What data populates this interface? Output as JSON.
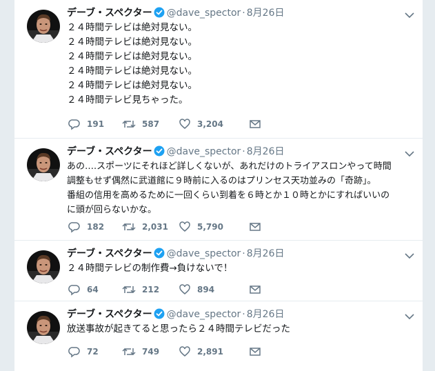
{
  "tweets": [
    {
      "name": "デーブ・スペクター",
      "handle": "@dave_spector",
      "date": "8月26日",
      "lines": [
        "２４時間テレビは絶対見ない。",
        "２４時間テレビは絶対見ない。",
        "２４時間テレビは絶対見ない。",
        "２４時間テレビは絶対見ない。",
        "２４時間テレビは絶対見ない。",
        "２４時間テレビ見ちゃった。"
      ],
      "replies": "191",
      "retweets": "587",
      "likes": "3,204"
    },
    {
      "name": "デーブ・スペクター",
      "handle": "@dave_spector",
      "date": "8月26日",
      "lines": [
        "あの….スポーツにそれほど詳しくないが、あれだけのトライアスロンやって時間",
        "調整もせず偶然に武道館に９時前に入るのはプリンセス天功並みの「奇跡」。",
        "番組の信用を高めるために一回くらい到着を６時とか１０時とかにすればいいの",
        "に頭が回らないかな。"
      ],
      "replies": "182",
      "retweets": "2,031",
      "likes": "5,790"
    },
    {
      "name": "デーブ・スペクター",
      "handle": "@dave_spector",
      "date": "8月26日",
      "lines": [
        "２４時間テレビの制作費→負けないで！"
      ],
      "replies": "64",
      "retweets": "212",
      "likes": "894"
    },
    {
      "name": "デーブ・スペクター",
      "handle": "@dave_spector",
      "date": "8月26日",
      "lines": [
        "放送事故が起きてると思ったら２４時間テレビだった"
      ],
      "replies": "72",
      "retweets": "749",
      "likes": "2,891"
    }
  ],
  "colors": {
    "background": "#e6ecf0",
    "card": "#ffffff",
    "text": "#14171a",
    "muted": "#657786",
    "verified": "#1da1f2"
  },
  "icons": {
    "reply": "reply-icon",
    "retweet": "retweet-icon",
    "like": "heart-icon",
    "dm": "envelope-icon",
    "more": "chevron-down-icon",
    "verified": "verified-badge-icon"
  }
}
